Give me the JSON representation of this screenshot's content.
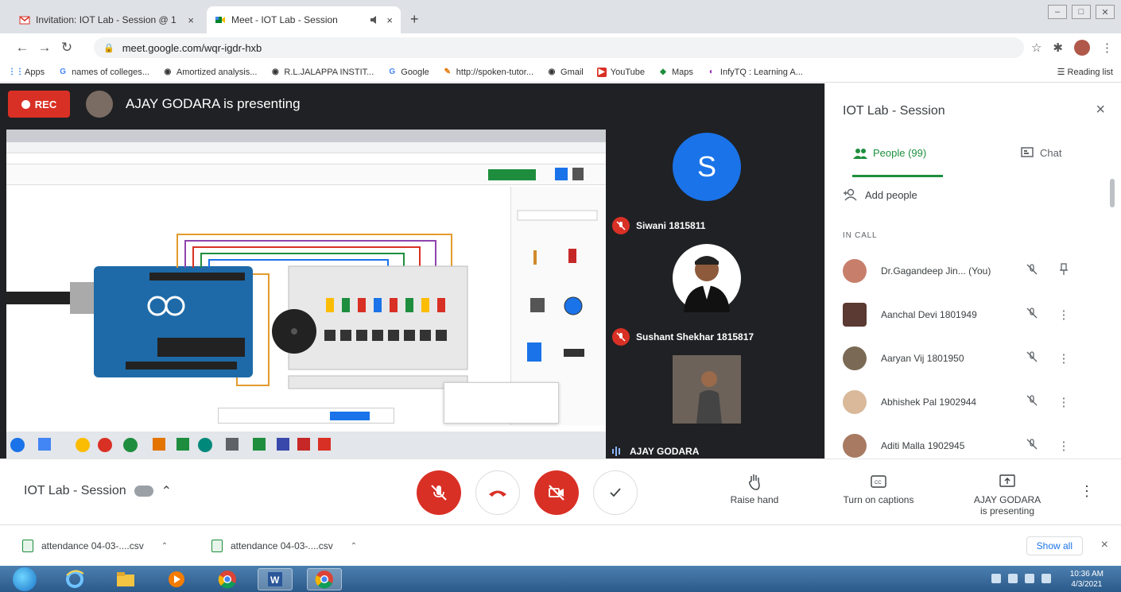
{
  "browser": {
    "tabs": [
      {
        "title": "Invitation: IOT Lab - Session @ 1",
        "close": "×",
        "active": false
      },
      {
        "title": "Meet - IOT Lab - Session",
        "close": "×",
        "active": true
      }
    ],
    "new_tab": "+",
    "url": "meet.google.com/wqr-igdr-hxb",
    "bookmarks": [
      "Apps",
      "names of colleges...",
      "Amortized analysis...",
      "R.L.JALAPPA INSTIT...",
      "Google",
      "http://spoken-tutor...",
      "Gmail",
      "YouTube",
      "Maps",
      "InfyTQ : Learning A..."
    ],
    "reading_list": "Reading list"
  },
  "meet": {
    "rec_label": "REC",
    "presenting_banner": "AJAY GODARA is presenting",
    "tiles": [
      {
        "initial": "S",
        "name": "Siwani 1815811",
        "color": "#1a73e8"
      },
      {
        "initial": "",
        "name": "Sushant Shekhar 1815817",
        "color": "#ffffff"
      },
      {
        "initial": "",
        "name": "AJAY GODARA",
        "color": "#5b5048"
      }
    ],
    "panel": {
      "title": "IOT Lab - Session",
      "close": "×",
      "tab_people": "People (99)",
      "tab_chat": "Chat",
      "add_people": "Add people",
      "section_label": "IN CALL",
      "participants": [
        {
          "name": "Dr.Gagandeep Jin... (You)",
          "avatar": "#c77f6b"
        },
        {
          "name": "Aanchal Devi 1801949",
          "avatar": "#5a3a32"
        },
        {
          "name": "Aaryan Vij 1801950",
          "avatar": "#7a6a55"
        },
        {
          "name": "Abhishek Pal 1902944",
          "avatar": "#d9b99a"
        },
        {
          "name": "Aditi Malla 1902945",
          "avatar": "#a87a62"
        }
      ]
    },
    "bottom": {
      "meeting_title": "IOT Lab - Session",
      "raise_hand": "Raise hand",
      "captions": "Turn on captions",
      "presenting_line1": "AJAY GODARA",
      "presenting_line2": "is presenting"
    }
  },
  "downloads": {
    "items": [
      "attendance 04-03-....csv",
      "attendance 04-03-....csv"
    ],
    "show_all": "Show all",
    "close": "×"
  },
  "taskbar": {
    "time": "10:36 AM",
    "date": "4/3/2021"
  },
  "colors": {
    "meet_red": "#d93025",
    "meet_green": "#1e8e3e",
    "stage_bg": "#202124"
  }
}
